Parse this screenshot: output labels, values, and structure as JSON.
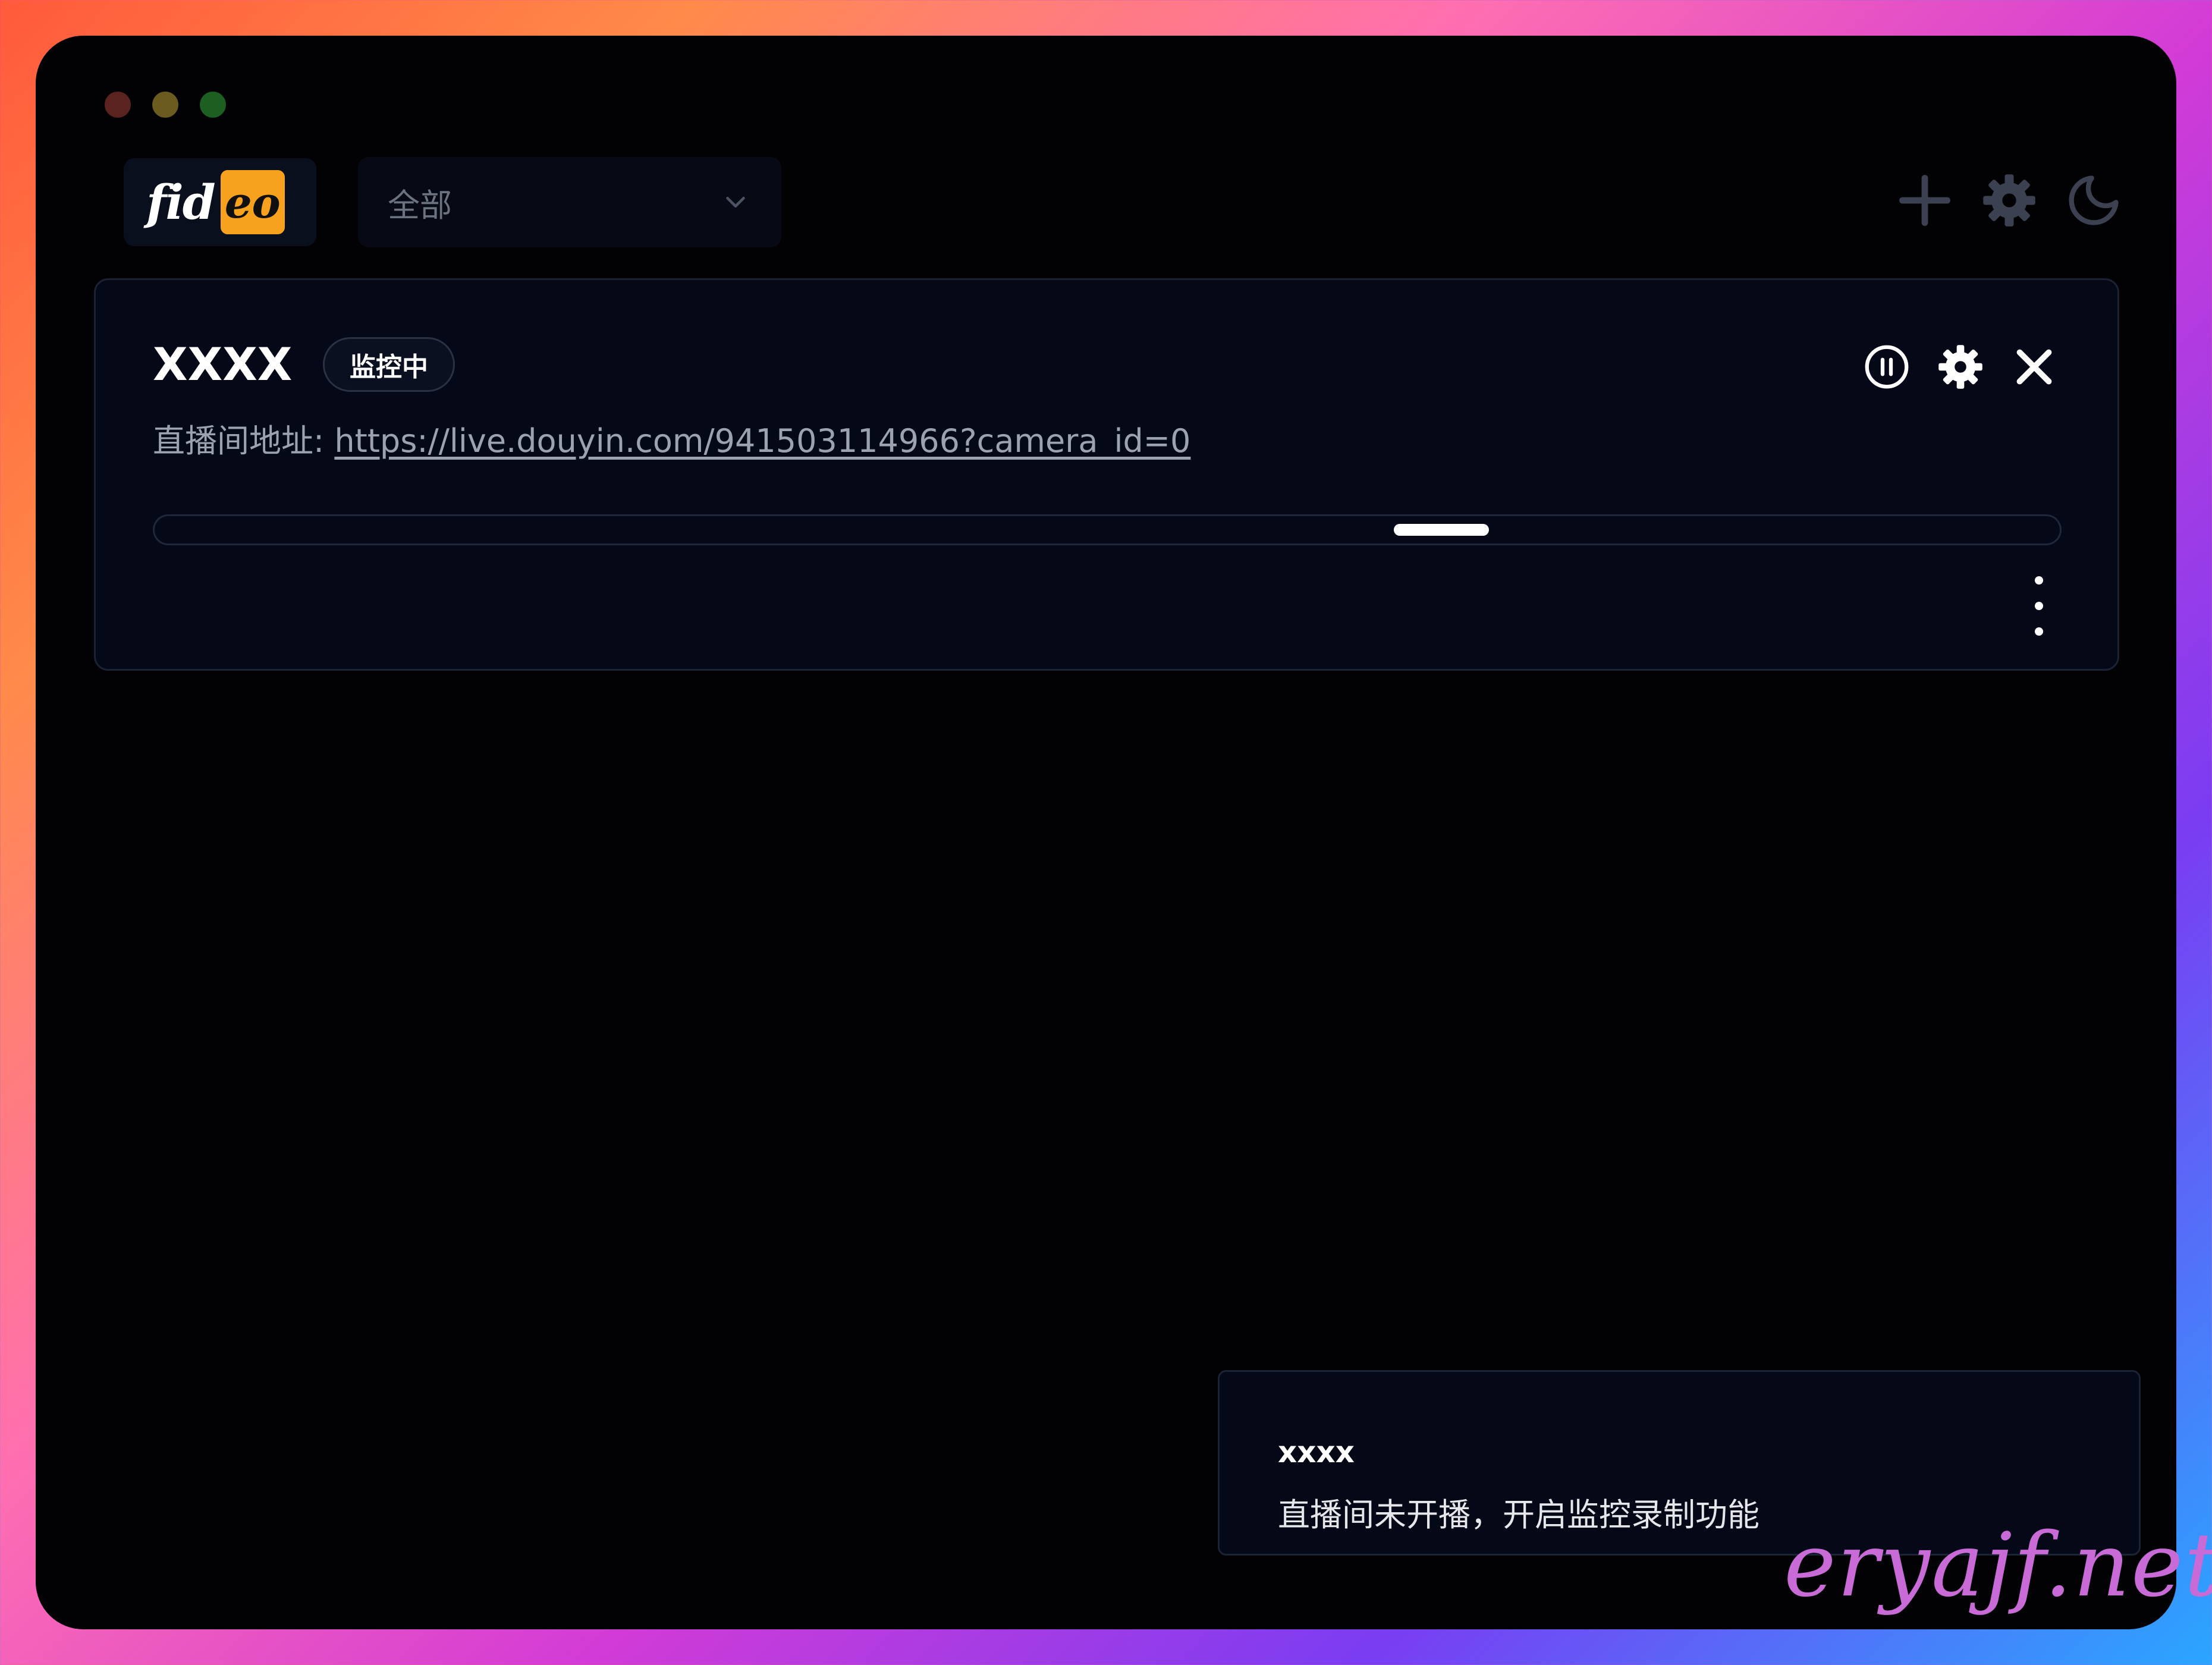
{
  "header": {
    "logo_left": "fid",
    "logo_right": "eo",
    "filter": {
      "selected": "全部"
    },
    "actions": [
      {
        "name": "add",
        "icon": "plus-icon"
      },
      {
        "name": "settings",
        "icon": "gear-icon"
      },
      {
        "name": "theme",
        "icon": "moon-icon"
      }
    ]
  },
  "card": {
    "title": "XXXX",
    "status_badge": "监控中",
    "url_label": "直播间地址: ",
    "url": "https://live.douyin.com/941503114966?camera_id=0",
    "actions": [
      {
        "name": "pause",
        "icon": "pause-circle-icon"
      },
      {
        "name": "settings",
        "icon": "gear-icon"
      },
      {
        "name": "close",
        "icon": "close-icon"
      }
    ],
    "more_icon": "kebab-menu-icon"
  },
  "toast": {
    "title": "xxxx",
    "message": "直播间未开播，开启监控录制功能"
  },
  "watermark": "eryajf.net",
  "colors": {
    "window_bg": "#020204",
    "card_bg": "#050917",
    "logo_accent": "#f6a21f",
    "muted_text": "#9ca3af",
    "icon_muted": "#3b4150"
  }
}
